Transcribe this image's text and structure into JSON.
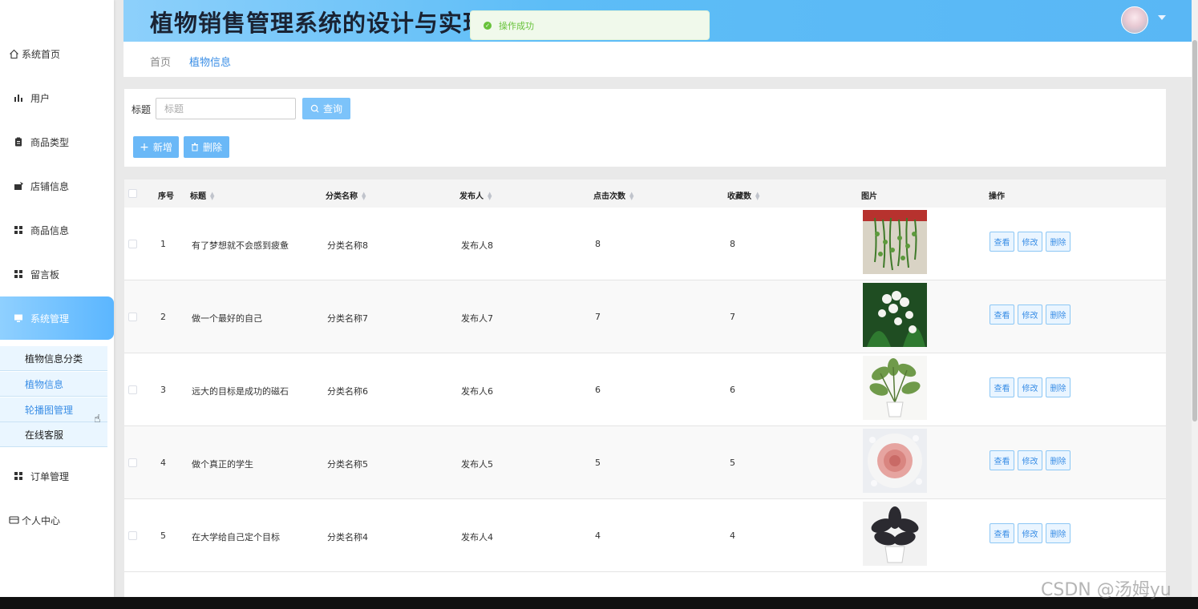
{
  "app": {
    "title": "植物销售管理系统的设计与实现"
  },
  "toast": {
    "message": "操作成功",
    "color": "#67c23a"
  },
  "colors": {
    "accent": "#5bb6ff",
    "link": "#3a8ee6"
  },
  "sidebar": {
    "items": [
      {
        "label": "系统首页",
        "icon": "home-icon"
      },
      {
        "label": "用户",
        "icon": "bar-chart-icon"
      },
      {
        "label": "商品类型",
        "icon": "clipboard-icon"
      },
      {
        "label": "店铺信息",
        "icon": "store-icon"
      },
      {
        "label": "商品信息",
        "icon": "grid-icon"
      },
      {
        "label": "留言板",
        "icon": "grid-icon"
      },
      {
        "label": "系统管理",
        "icon": "monitor-icon"
      },
      {
        "label": "订单管理",
        "icon": "grid-icon"
      },
      {
        "label": "个人中心",
        "icon": "id-card-icon"
      }
    ],
    "subitems": [
      "植物信息分类",
      "植物信息",
      "轮播图管理",
      "在线客服"
    ]
  },
  "breadcrumb": {
    "home": "首页",
    "current": "植物信息"
  },
  "search": {
    "label": "标题",
    "placeholder": "标题",
    "query_label": "查询"
  },
  "actions": {
    "add_label": "新增",
    "delete_label": "删除"
  },
  "table": {
    "headers": {
      "index": "序号",
      "title": "标题",
      "category": "分类名称",
      "publisher": "发布人",
      "clicks": "点击次数",
      "favorites": "收藏数",
      "image": "图片",
      "ops": "操作"
    },
    "op_labels": {
      "view": "查看",
      "edit": "修改",
      "delete": "删除"
    },
    "rows": [
      {
        "index": "1",
        "title": "有了梦想就不会感到疲惫",
        "category": "分类名称8",
        "publisher": "发布人8",
        "clicks": "8",
        "favorites": "8"
      },
      {
        "index": "2",
        "title": "做一个最好的自己",
        "category": "分类名称7",
        "publisher": "发布人7",
        "clicks": "7",
        "favorites": "7"
      },
      {
        "index": "3",
        "title": "远大的目标是成功的磁石",
        "category": "分类名称6",
        "publisher": "发布人6",
        "clicks": "6",
        "favorites": "6"
      },
      {
        "index": "4",
        "title": "做个真正的学生",
        "category": "分类名称5",
        "publisher": "发布人5",
        "clicks": "5",
        "favorites": "5"
      },
      {
        "index": "5",
        "title": "在大学给自己定个目标",
        "category": "分类名称4",
        "publisher": "发布人4",
        "clicks": "4",
        "favorites": "4"
      }
    ]
  },
  "watermark": "CSDN @汤姆yu"
}
